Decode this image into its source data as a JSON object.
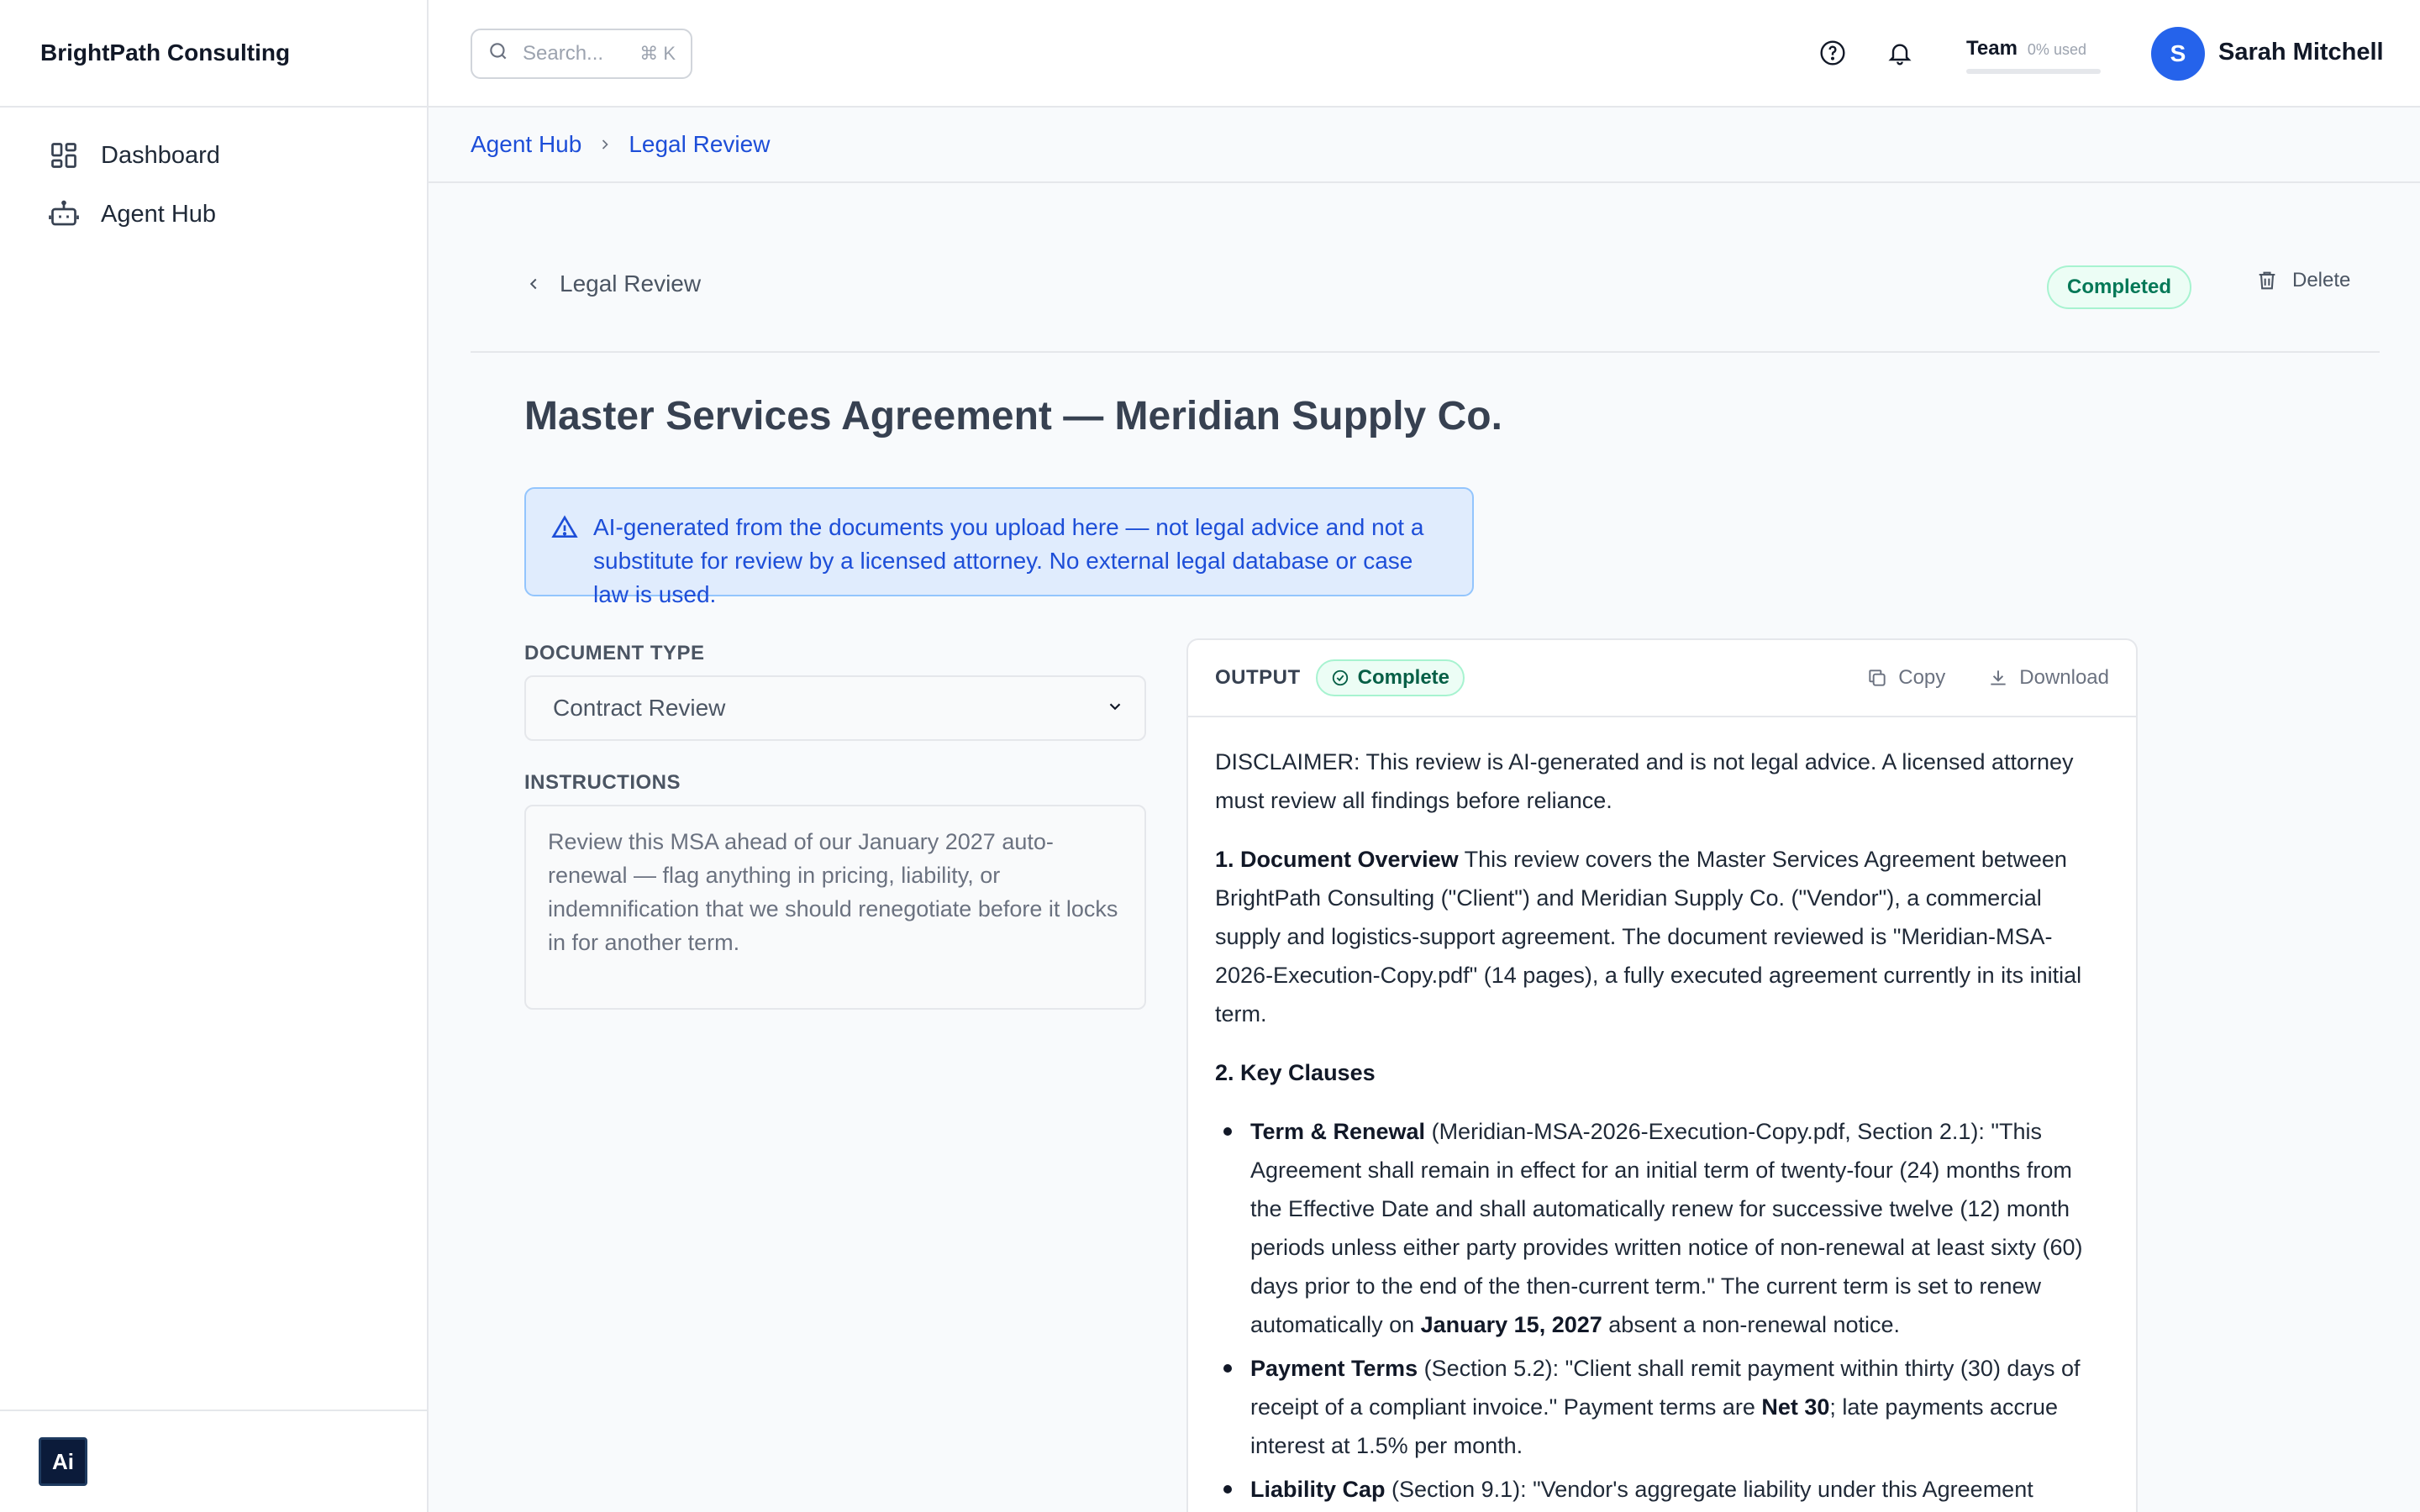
{
  "app": {
    "brand": "BrightPath Consulting"
  },
  "sidebar": {
    "items": [
      {
        "label": "Dashboard",
        "icon": "dashboard-grid-icon"
      },
      {
        "label": "Agent Hub",
        "icon": "robot-icon"
      }
    ],
    "footer_logo_text": "Ai"
  },
  "topbar": {
    "search_placeholder": "Search...",
    "search_shortcut": "⌘ K",
    "team_label": "Team",
    "team_used": "0% used",
    "team_usage_percent": 0,
    "user_initial": "S",
    "user_name": "Sarah Mitchell"
  },
  "breadcrumb": [
    "Agent Hub",
    "Legal Review"
  ],
  "header": {
    "back_label": "Legal Review",
    "status": "Completed",
    "delete_label": "Delete"
  },
  "page": {
    "title": "Master Services Agreement — Meridian Supply Co.",
    "notice": "AI-generated from the documents you upload here — not legal advice and not a substitute for review by a licensed attorney. No external legal database or case law is used."
  },
  "form": {
    "doc_type_label": "DOCUMENT TYPE",
    "doc_type_value": "Contract Review",
    "instructions_label": "INSTRUCTIONS",
    "instructions_value": "Review this MSA ahead of our January 2027 auto-renewal — flag anything in pricing, liability, or indemnification that we should renegotiate before it locks in for another term."
  },
  "output": {
    "label": "OUTPUT",
    "status": "Complete",
    "copy_label": "Copy",
    "download_label": "Download",
    "disclaimer": "DISCLAIMER: This review is AI-generated and is not legal advice. A licensed attorney must review all findings before reliance.",
    "overview_heading": "1. Document Overview",
    "overview_text": " This review covers the Master Services Agreement between BrightPath Consulting (\"Client\") and Meridian Supply Co. (\"Vendor\"), a commercial supply and logistics-support agreement. The document reviewed is \"Meridian-MSA-2026-Execution-Copy.pdf\" (14 pages), a fully executed agreement currently in its initial term.",
    "key_clauses_heading": "2. Key Clauses",
    "clauses": [
      {
        "title": "Term & Renewal",
        "text_a": " (Meridian-MSA-2026-Execution-Copy.pdf, Section 2.1): \"This Agreement shall remain in effect for an initial term of twenty-four (24) months from the Effective Date and shall automatically renew for successive twelve (12) month periods unless either party provides written notice of non-renewal at least sixty (60) days prior to the end of the then-current term.\" The current term is set to renew automatically on ",
        "emph": "January 15, 2027",
        "text_b": " absent a non-renewal notice."
      },
      {
        "title": "Payment Terms",
        "text_a": " (Section 5.2): \"Client shall remit payment within thirty (30) days of receipt of a compliant invoice.\" Payment terms are ",
        "emph": "Net 30",
        "text_b": "; late payments accrue interest at 1.5% per month."
      },
      {
        "title": "Liability Cap",
        "text_a": " (Section 9.1): \"Vendor's aggregate liability under this Agreement",
        "emph": "",
        "text_b": ""
      }
    ]
  }
}
